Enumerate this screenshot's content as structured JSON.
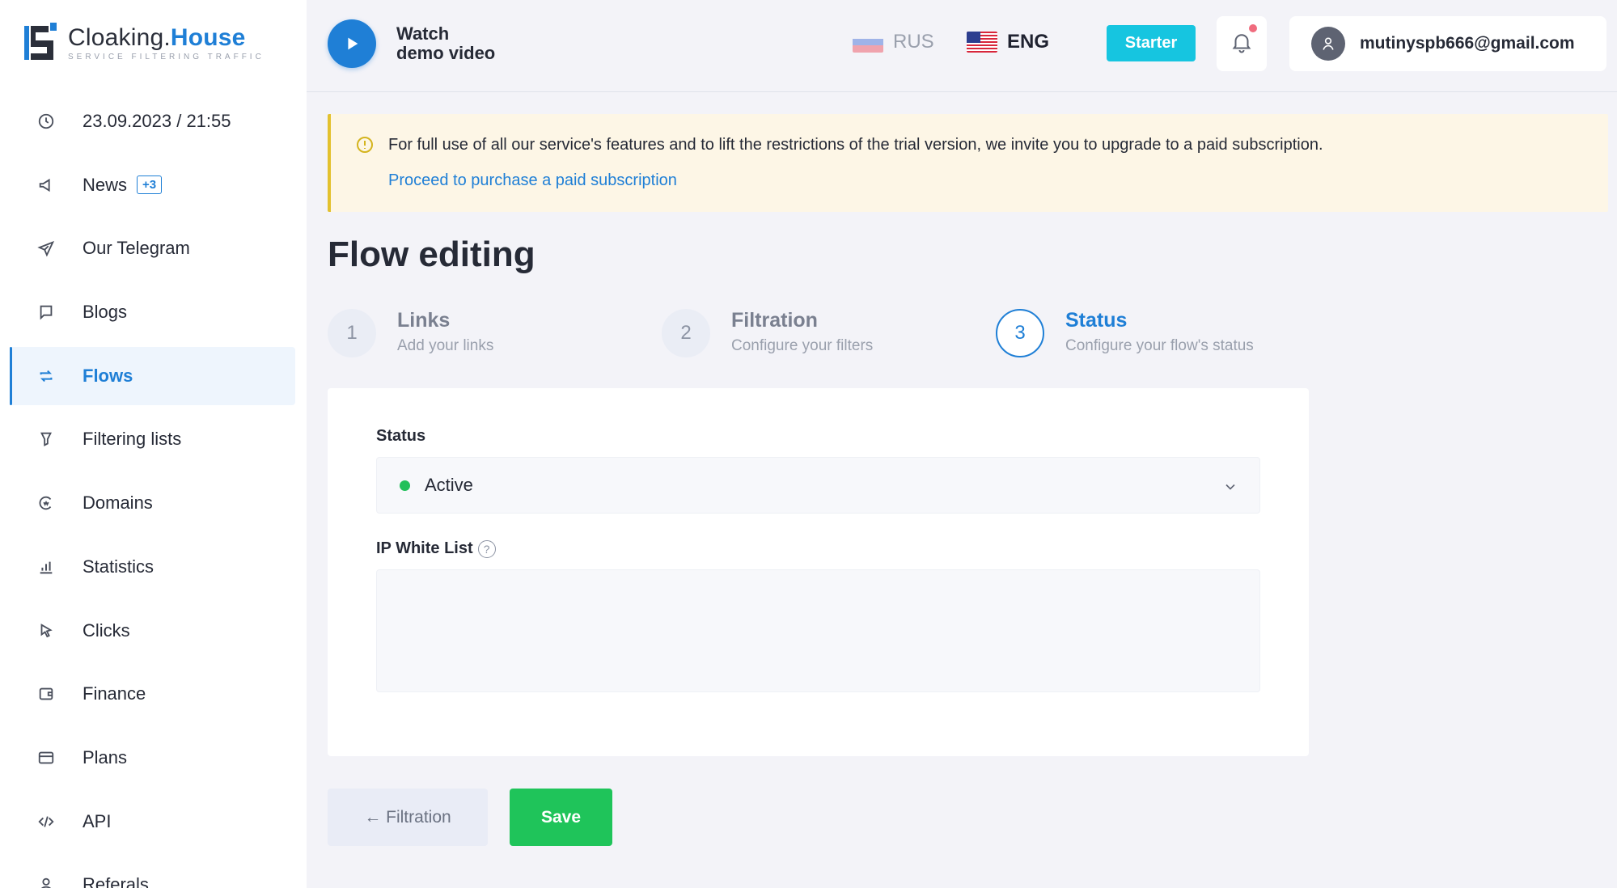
{
  "logo": {
    "name_part1": "Cloaking.",
    "name_part2": "House",
    "tagline": "SERVICE FILTERING TRAFFIC"
  },
  "sidebar": {
    "items": [
      {
        "label": "23.09.2023 / 21:55",
        "icon": "clock-icon"
      },
      {
        "label": "News",
        "icon": "megaphone-icon",
        "badge": "+3"
      },
      {
        "label": "Our Telegram",
        "icon": "telegram-icon"
      },
      {
        "label": "Blogs",
        "icon": "chat-icon"
      },
      {
        "label": "Flows",
        "icon": "flows-icon",
        "active": true
      },
      {
        "label": "Filtering lists",
        "icon": "filter-icon"
      },
      {
        "label": "Domains",
        "icon": "domain-icon"
      },
      {
        "label": "Statistics",
        "icon": "bar-chart-icon"
      },
      {
        "label": "Clicks",
        "icon": "cursor-icon"
      },
      {
        "label": "Finance",
        "icon": "wallet-icon"
      },
      {
        "label": "Plans",
        "icon": "card-icon"
      },
      {
        "label": "API",
        "icon": "code-icon"
      },
      {
        "label": "Referals",
        "icon": "user-icon"
      }
    ]
  },
  "topbar": {
    "demo_line1": "Watch",
    "demo_line2": "demo video",
    "lang_rus": "RUS",
    "lang_eng": "ENG",
    "plan": "Starter",
    "user_email": "mutinyspb666@gmail.com"
  },
  "alert": {
    "text": "For full use of all our service's features and to lift the restrictions of the trial version, we invite you to upgrade to a paid subscription.",
    "link": "Proceed to purchase a paid subscription"
  },
  "page": {
    "title": "Flow editing"
  },
  "steps": [
    {
      "num": "1",
      "title": "Links",
      "sub": "Add your links"
    },
    {
      "num": "2",
      "title": "Filtration",
      "sub": "Configure your filters"
    },
    {
      "num": "3",
      "title": "Status",
      "sub": "Configure your flow's status"
    }
  ],
  "form": {
    "status_label": "Status",
    "status_value": "Active",
    "ip_label": "IP White List",
    "ip_value": ""
  },
  "buttons": {
    "back": "← Filtration",
    "save": "Save"
  },
  "colors": {
    "accent": "#1f7fd6",
    "save": "#1fc45a",
    "starter": "#16c5e0",
    "active_dot": "#22c05a",
    "alert_border": "#e3c12f"
  }
}
